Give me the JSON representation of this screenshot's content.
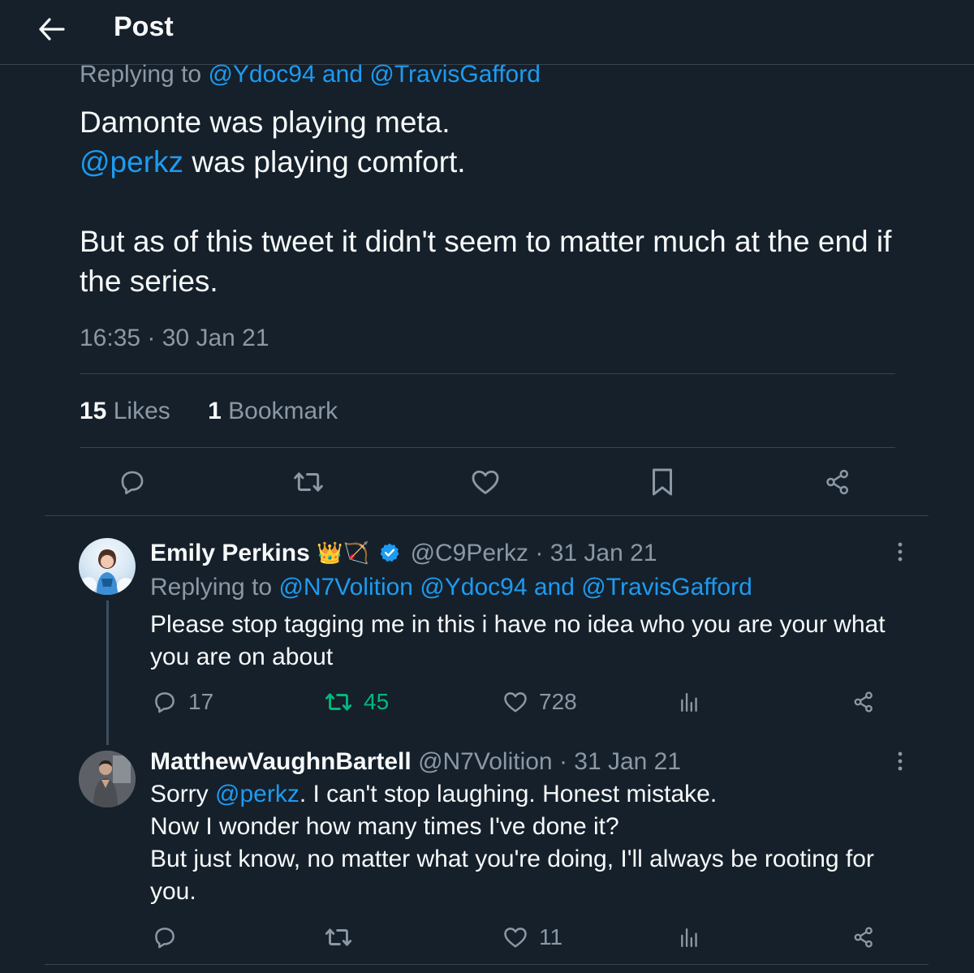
{
  "header": {
    "title": "Post",
    "back_icon": "arrow-left-icon"
  },
  "main_post": {
    "replying_prefix": "Replying to",
    "replying_to_1": "@Ydoc94",
    "replying_and": "and",
    "replying_to_2": "@TravisGafford",
    "line1": "Damonte was playing meta.",
    "mention": "@perkz",
    "line2_rest": " was playing comfort.",
    "line3": "But as of this tweet it didn't seem to matter much at the end if the series.",
    "timestamp": "16:35 · 30 Jan 21",
    "likes_count": "15",
    "likes_label": "Likes",
    "bookmarks_count": "1",
    "bookmarks_label": "Bookmark"
  },
  "actions": {
    "icons": [
      "reply-icon",
      "retweet-icon",
      "like-icon",
      "bookmark-icon",
      "share-icon"
    ]
  },
  "reply1": {
    "name": "Emily Perkins",
    "name_emoji": "👑🏹",
    "verified": true,
    "handle_date": "@C9Perkz · 31 Jan 21",
    "replying_prefix": "Replying to",
    "replying_to_1": "@N7Volition",
    "replying_to_2": "@Ydoc94",
    "replying_and": "and",
    "replying_to_3": "@TravisGafford",
    "text": "Please stop tagging me in this i have no idea who you are your what you are on about",
    "reply_count": "17",
    "retweet_count": "45",
    "like_count": "728"
  },
  "reply2": {
    "name": "MatthewVaughnBartell",
    "handle_date": "@N7Volition · 31 Jan 21",
    "text_prefix": "Sorry ",
    "mention": "@perkz",
    "text_suffix": ". I can't stop laughing. Honest mistake.",
    "line2": "Now I wonder how many times I've done it?",
    "line3": "But just know, no matter what you're doing, I'll always be rooting for you.",
    "like_count": "11"
  },
  "colors": {
    "background": "#15202b",
    "text": "#f7f9f9",
    "secondary": "#8b98a5",
    "link": "#1d9bf0",
    "retweet_active": "#00ba7c",
    "divider": "#38444d"
  }
}
